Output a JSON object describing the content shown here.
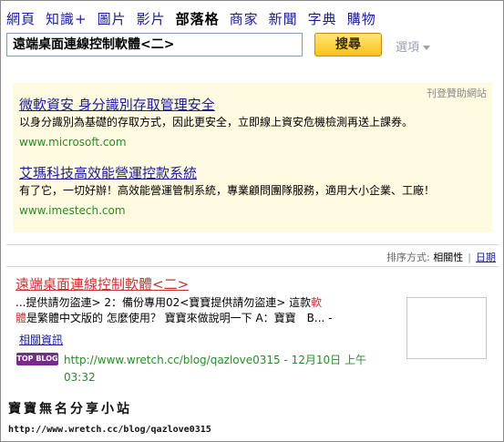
{
  "nav": {
    "items": [
      "網頁",
      "知識+",
      "圖片",
      "影片",
      "部落格",
      "商家",
      "新聞",
      "字典",
      "購物"
    ],
    "active_index": 4
  },
  "search": {
    "query": "遠端桌面連線控制軟體<二>",
    "button_label": "搜尋",
    "options_label": "選項"
  },
  "ads": {
    "label": "刊登贊助網站",
    "items": [
      {
        "title": "微軟資安 身分識別存取管理安全",
        "desc": "以身分識別為基礎的存取方式，因此更安全，立即線上資安危機檢測再送上課券。",
        "url": "www.microsoft.com"
      },
      {
        "title": "艾瑪科技高效能營運控款系統",
        "desc": "有了它，一切好辦！高效能營運管制系統，專業顧問團隊服務，適用大小企業、工廠！",
        "url": "www.imestech.com"
      }
    ]
  },
  "sort": {
    "label": "排序方式:",
    "current": "相關性",
    "separator": "|",
    "other": "日期"
  },
  "result": {
    "title": "遠端桌面連線控制軟體<二>",
    "snippet_before": "...提供請勿盜連> 2：備份專用02<寶寶提供請勿盜連> 這款",
    "snippet_hl1": "軟",
    "snippet_hl2": "體",
    "snippet_after": "是繁體中文版的 怎麼使用？ 寶寶來做說明一下 A：寶寶　B... -",
    "related": "相關資訊",
    "badge": "TOP BLOG",
    "url_line": "http://www.wretch.cc/blog/qazlove0315 - 12月10日 上午",
    "time": "03:32"
  },
  "watermark": {
    "title": "寶寶無名分享小站",
    "url": "http://www.wretch.cc/blog/qazlove0315"
  },
  "colors": {
    "link": "#1a1a9a",
    "result_title": "#cc3333",
    "url_green": "#2a8a2a",
    "ad_bg": "#fffae0",
    "button": "#f7c21b"
  }
}
